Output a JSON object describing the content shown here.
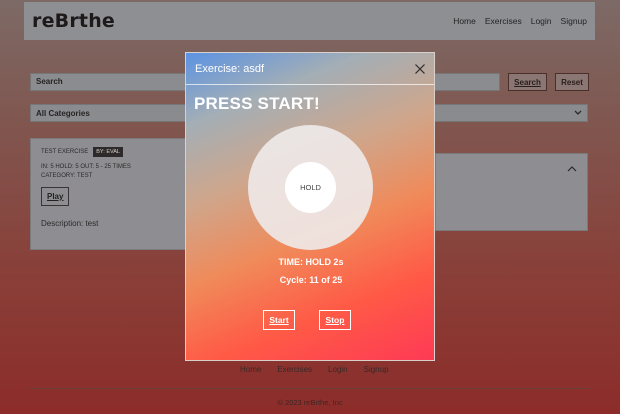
{
  "header": {
    "logo": "reBrthe",
    "nav": [
      "Home",
      "Exercises",
      "Login",
      "Signup"
    ]
  },
  "search": {
    "placeholder": "Search",
    "search_label": "Search",
    "reset_label": "Reset"
  },
  "filter": {
    "selected": "All Categories"
  },
  "exercise_card": {
    "name": "TEST EXERCISE",
    "badge": "BY: EVAL",
    "pattern": "IN: 5 HOLD: 5 OUT: 5 - 25 TIMES",
    "category": "CATEGORY: TEST",
    "play_label": "Play",
    "description": "Description: test"
  },
  "modal": {
    "title": "Exercise: asdf",
    "heading": "PRESS START!",
    "circle_label": "HOLD",
    "timer": "TIME: HOLD 2s",
    "cycle": "Cycle: 11 of 25",
    "start_label": "Start",
    "stop_label": "Stop"
  },
  "footer": {
    "links": [
      "Home",
      "Exercises",
      "Login",
      "Signup"
    ],
    "copyright": "© 2023 reBrthe, Inc"
  }
}
